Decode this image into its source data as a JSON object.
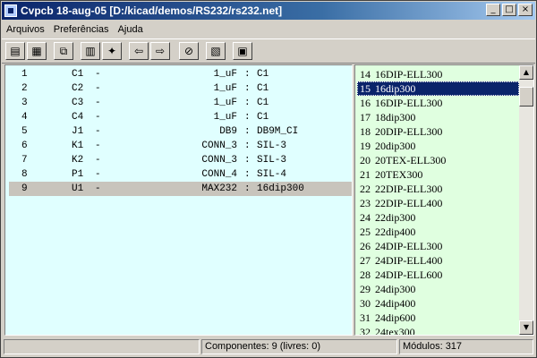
{
  "window": {
    "title": "Cvpcb 18-aug-05 [D:/kicad/demos/RS232/rs232.net]",
    "controls": {
      "minimize": "_",
      "maximize": "□",
      "close": "×"
    }
  },
  "menu": [
    "Arquivos",
    "Preferências",
    "Ajuda"
  ],
  "toolbar": {
    "icons": [
      "load-netlist-icon",
      "save-netlist-icon",
      "display-footprint-icon",
      "library-settings-icon",
      "auto-associate-icon",
      "previous-icon",
      "next-icon",
      "delete-associations-icon",
      "create-stuff-file-icon",
      "documentation-icon"
    ],
    "glyphs": [
      "▤",
      "▦",
      "⧉",
      "▥",
      "✦",
      "⇦",
      "⇨",
      "⊘",
      "▧",
      "▣"
    ]
  },
  "components": [
    {
      "num": "1",
      "ref": "C1",
      "dash": "-",
      "value": "1_uF",
      "colon": ":",
      "footprint": "C1"
    },
    {
      "num": "2",
      "ref": "C2",
      "dash": "-",
      "value": "1_uF",
      "colon": ":",
      "footprint": "C1"
    },
    {
      "num": "3",
      "ref": "C3",
      "dash": "-",
      "value": "1_uF",
      "colon": ":",
      "footprint": "C1"
    },
    {
      "num": "4",
      "ref": "C4",
      "dash": "-",
      "value": "1_uF",
      "colon": ":",
      "footprint": "C1"
    },
    {
      "num": "5",
      "ref": "J1",
      "dash": "-",
      "value": "DB9",
      "colon": ":",
      "footprint": "DB9M_CI"
    },
    {
      "num": "6",
      "ref": "K1",
      "dash": "-",
      "value": "CONN_3",
      "colon": ":",
      "footprint": "SIL-3"
    },
    {
      "num": "7",
      "ref": "K2",
      "dash": "-",
      "value": "CONN_3",
      "colon": ":",
      "footprint": "SIL-3"
    },
    {
      "num": "8",
      "ref": "P1",
      "dash": "-",
      "value": "CONN_4",
      "colon": ":",
      "footprint": "SIL-4"
    },
    {
      "num": "9",
      "ref": "U1",
      "dash": "-",
      "value": "MAX232",
      "colon": ":",
      "footprint": "16dip300",
      "selected": true
    }
  ],
  "modules": [
    {
      "num": "14",
      "name": "16DIP-ELL300"
    },
    {
      "num": "15",
      "name": "16dip300",
      "selected": true
    },
    {
      "num": "16",
      "name": "16DIP-ELL300"
    },
    {
      "num": "17",
      "name": "18dip300"
    },
    {
      "num": "18",
      "name": "20DIP-ELL300"
    },
    {
      "num": "19",
      "name": "20dip300"
    },
    {
      "num": "20",
      "name": "20TEX-ELL300"
    },
    {
      "num": "21",
      "name": "20TEX300"
    },
    {
      "num": "22",
      "name": "22DIP-ELL300"
    },
    {
      "num": "23",
      "name": "22DIP-ELL400"
    },
    {
      "num": "24",
      "name": "22dip300"
    },
    {
      "num": "25",
      "name": "22dip400"
    },
    {
      "num": "26",
      "name": "24DIP-ELL300"
    },
    {
      "num": "27",
      "name": "24DIP-ELL400"
    },
    {
      "num": "28",
      "name": "24DIP-ELL600"
    },
    {
      "num": "29",
      "name": "24dip300"
    },
    {
      "num": "30",
      "name": "24dip400"
    },
    {
      "num": "31",
      "name": "24dip600"
    },
    {
      "num": "32",
      "name": "24tex300"
    }
  ],
  "scrollbar": {
    "up": "▲",
    "down": "▼"
  },
  "status": {
    "components": "Componentes: 9 (livres: 0)",
    "modules": "Módulos: 317"
  }
}
